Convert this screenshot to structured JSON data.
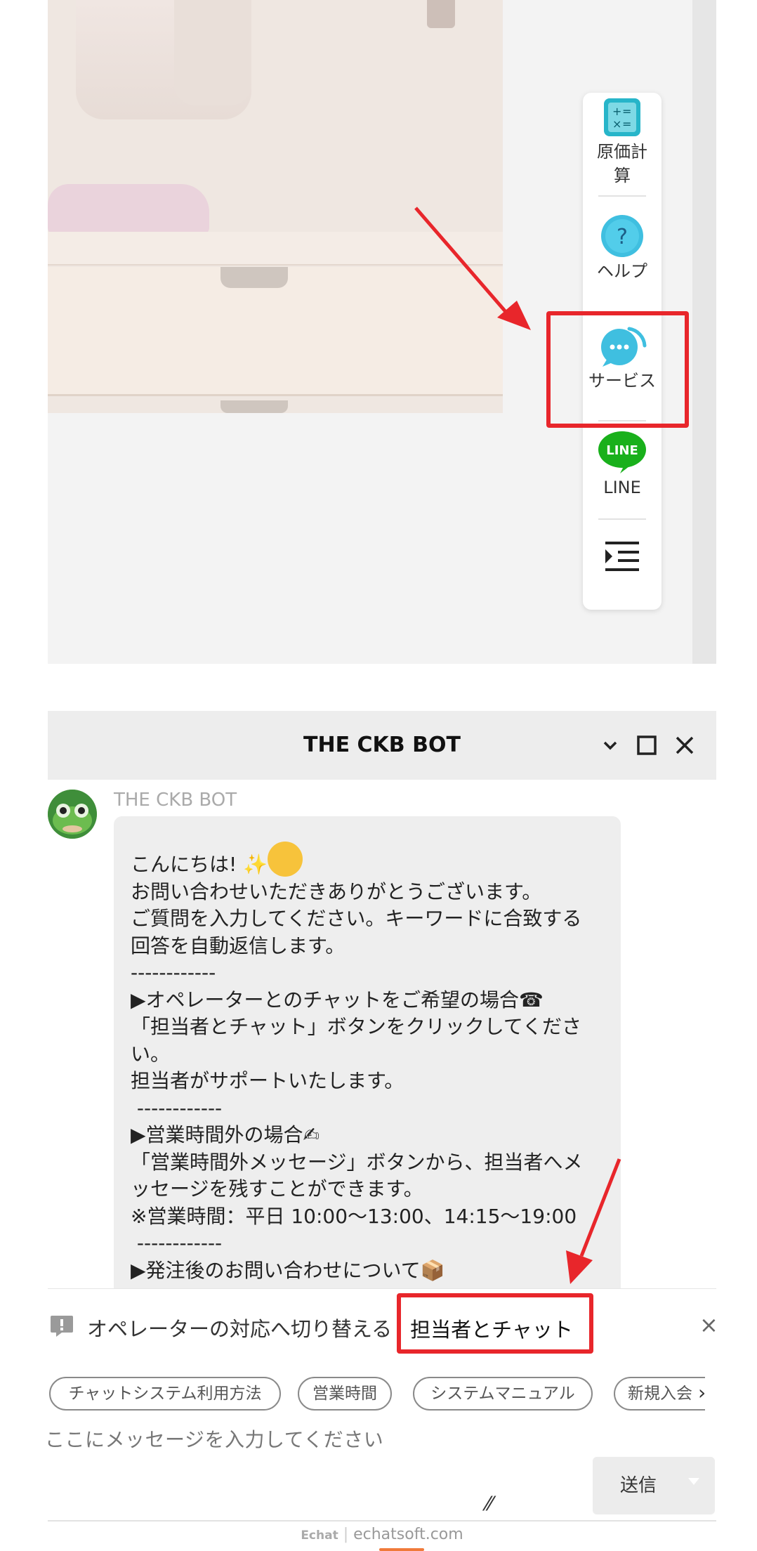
{
  "toolbar": {
    "items": [
      {
        "label": "原価計算",
        "line1": "原価計",
        "line2": "算",
        "icon": "calculator-icon"
      },
      {
        "label": "ヘルプ",
        "icon": "help-icon"
      },
      {
        "label": "サービス",
        "icon": "service-chat-icon"
      },
      {
        "label": "LINE",
        "icon": "line-app-icon",
        "icon_text": "LINE"
      },
      {
        "label": "",
        "icon": "menu-collapse-icon"
      }
    ]
  },
  "chat": {
    "title": "THE CKB BOT",
    "bot_name": "THE CKB BOT",
    "message_lines": [
      "こんにちは!",
      "お問い合わせいただきありがとうございます。",
      "ご質問を入力してください。キーワードに合致する",
      "回答を自動返信します。",
      "------------",
      "▶オペレーターとのチャットをご希望の場合☎",
      "「担当者とチャット」ボタンをクリックしてくださ",
      "い。",
      "担当者がサポートいたします。",
      " ------------",
      "▶営業時間外の場合✍",
      "「営業時間外メッセージ」ボタンから、担当者へメ",
      "ッセージを残すことができます。",
      "※営業時間：平日 10:00～13:00、14:15～19:00",
      " ------------",
      "▶発注後のお問い合わせについて📦"
    ],
    "switch_text": "オペレーターの対応へ切り替える",
    "operator_button": "担当者とチャット",
    "quick_replies": [
      "チャットシステム利用方法",
      "営業時間",
      "システムマニュアル",
      "新規入会"
    ],
    "input_placeholder": "ここにメッセージを入力してください",
    "send_label": "送信",
    "footer_logo": "Echat",
    "footer_domain": "echatsoft.com"
  },
  "colors": {
    "highlight": "#e8262b",
    "line_green": "#19b01b",
    "help_blue": "#3fbfe0"
  }
}
